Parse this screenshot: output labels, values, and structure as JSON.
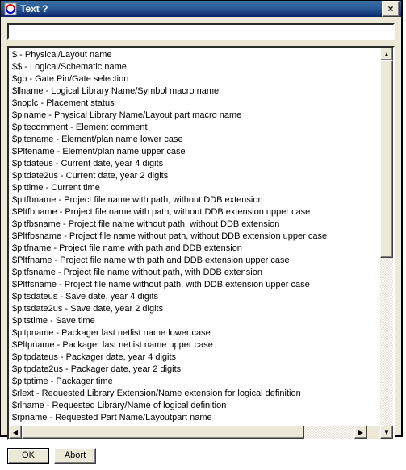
{
  "window": {
    "title": "Text ?"
  },
  "input": {
    "value": "",
    "placeholder": ""
  },
  "buttons": {
    "ok": "OK",
    "abort": "Abort",
    "close": "×"
  },
  "scroll": {
    "up": "▲",
    "down": "▼",
    "left": "◀",
    "right": "▶"
  },
  "list": [
    "$ - Physical/Layout name",
    "$$ - Logical/Schematic name",
    "$gp - Gate Pin/Gate selection",
    "$llname - Logical Library Name/Symbol macro name",
    "$noplc - Placement status",
    "$plname - Physical Library Name/Layout part macro name",
    "$pltecomment - Element comment",
    "$pltename - Element/plan name lower case",
    "$Pltename - Element/plan name upper case",
    "$pltdateus - Current date, year 4 digits",
    "$pltdate2us - Current date, year 2 digits",
    "$plttime - Current time",
    "$pltfbname - Project file name with path, without DDB extension",
    "$Pltfbname - Project file name with path, without DDB extension upper case",
    "$pltfbsname - Project file name without path, without DDB extension",
    "$Pltfbsname - Project file name without path, without DDB extension upper case",
    "$pltfname - Project file name with path and DDB extension",
    "$Pltfname - Project file name with path and DDB extension upper case",
    "$pltfsname - Project file name without path, with DDB extension",
    "$Pltfsname - Project file name without path, with DDB extension upper case",
    "$pltsdateus - Save date, year 4 digits",
    "$pltsdate2us - Save date, year 2 digits",
    "$pltstime - Save time",
    "$pltpname - Packager last netlist name lower case",
    "$Pltpname - Packager last netlist name upper case",
    "$pltpdateus - Packager date, year 4 digits",
    "$pltpdate2us - Packager date, year 2 digits",
    "$pltptime - Packager time",
    "$rlext - Requested Library Extension/Name extension for logical definition",
    "$rlname - Requested Library/Name of logical definition",
    "$rpname - Requested Part Name/Layoutpart name"
  ]
}
